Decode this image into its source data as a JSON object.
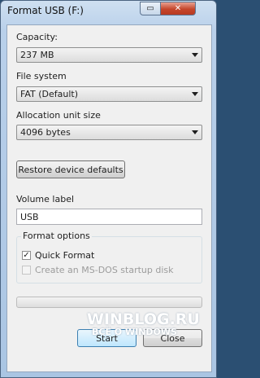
{
  "window": {
    "title": "Format USB (F:)",
    "minimize_glyph": "▭",
    "close_glyph": "✕"
  },
  "capacity": {
    "label": "Capacity:",
    "value": "237 MB"
  },
  "file_system": {
    "label": "File system",
    "value": "FAT (Default)"
  },
  "allocation": {
    "label": "Allocation unit size",
    "value": "4096 bytes"
  },
  "restore_button": "Restore device defaults",
  "volume": {
    "label": "Volume label",
    "value": "USB"
  },
  "format_options": {
    "title": "Format options",
    "quick_format": {
      "label": "Quick Format",
      "checked": true
    },
    "msdos_disk": {
      "label": "Create an MS-DOS startup disk",
      "checked": false,
      "enabled": false
    }
  },
  "progress": {
    "fraction": 0.0
  },
  "buttons": {
    "start": "Start",
    "close": "Close"
  },
  "watermark": {
    "line1": "WINBLOG.RU",
    "line2": "ВСЁ О WINDOWS"
  },
  "colors": {
    "window_frame": "#aac5e3",
    "close_button": "#c5452b",
    "client_bg": "#f0f0f0"
  }
}
